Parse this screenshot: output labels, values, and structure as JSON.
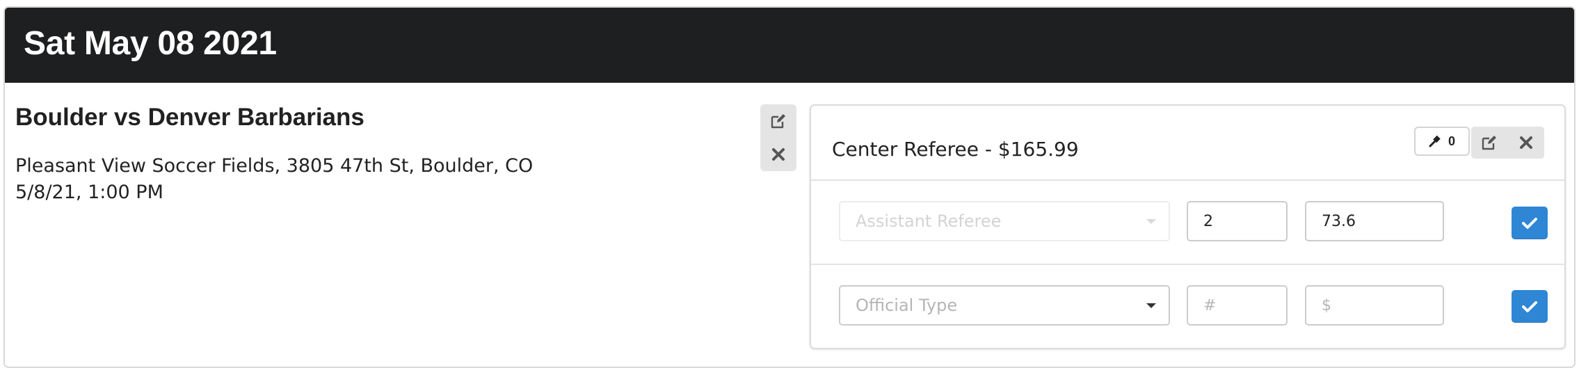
{
  "header": {
    "date": "Sat May 08 2021"
  },
  "game": {
    "title": "Boulder vs Denver Barbarians",
    "location": "Pleasant View Soccer Fields, 3805 47th St, Boulder, CO",
    "datetime": "5/8/21, 1:00 PM"
  },
  "position": {
    "title": "Center Referee - $165.99",
    "assign_count": "0"
  },
  "rows": [
    {
      "official_type": "Assistant Referee",
      "count": "2",
      "rate": "73.6",
      "type_disabled": true
    },
    {
      "official_type_placeholder": "Official Type",
      "count_placeholder": "#",
      "rate_placeholder": "$"
    }
  ],
  "icons": {
    "edit": "edit-icon",
    "close": "close-icon",
    "gavel": "gavel-icon",
    "check": "check-icon"
  },
  "colors": {
    "header_bg": "#1e1f21",
    "confirm": "#2e86d5",
    "action_bg": "#e4e4e4"
  }
}
